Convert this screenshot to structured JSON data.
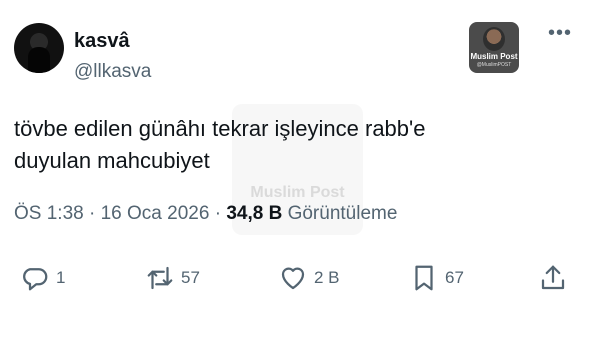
{
  "author": {
    "name": "kasvâ",
    "handle": "@llkasva"
  },
  "badge": {
    "line1": "Muslim Post",
    "line2": "@MuslimPOST"
  },
  "watermark": "Muslim Post",
  "tweet": {
    "line1": "tövbe edilen günâhı tekrar işleyince rabb'e",
    "line2": "duyulan mahcubiyet"
  },
  "meta": {
    "time": "ÖS 1:38",
    "sep1": " · ",
    "date": "16 Oca 2026",
    "sep2": " · ",
    "views": "34,8 B",
    "views_label": " Görüntüleme"
  },
  "actions": {
    "replies": "1",
    "reposts": "57",
    "likes": "2 B",
    "bookmarks": "67"
  },
  "icons": {
    "more": "more-horizontal-icon",
    "reply": "reply-icon",
    "repost": "repost-icon",
    "like": "heart-icon",
    "bookmark": "bookmark-icon",
    "share": "share-icon"
  },
  "colors": {
    "text": "#0f1419",
    "secondary": "#536471"
  }
}
